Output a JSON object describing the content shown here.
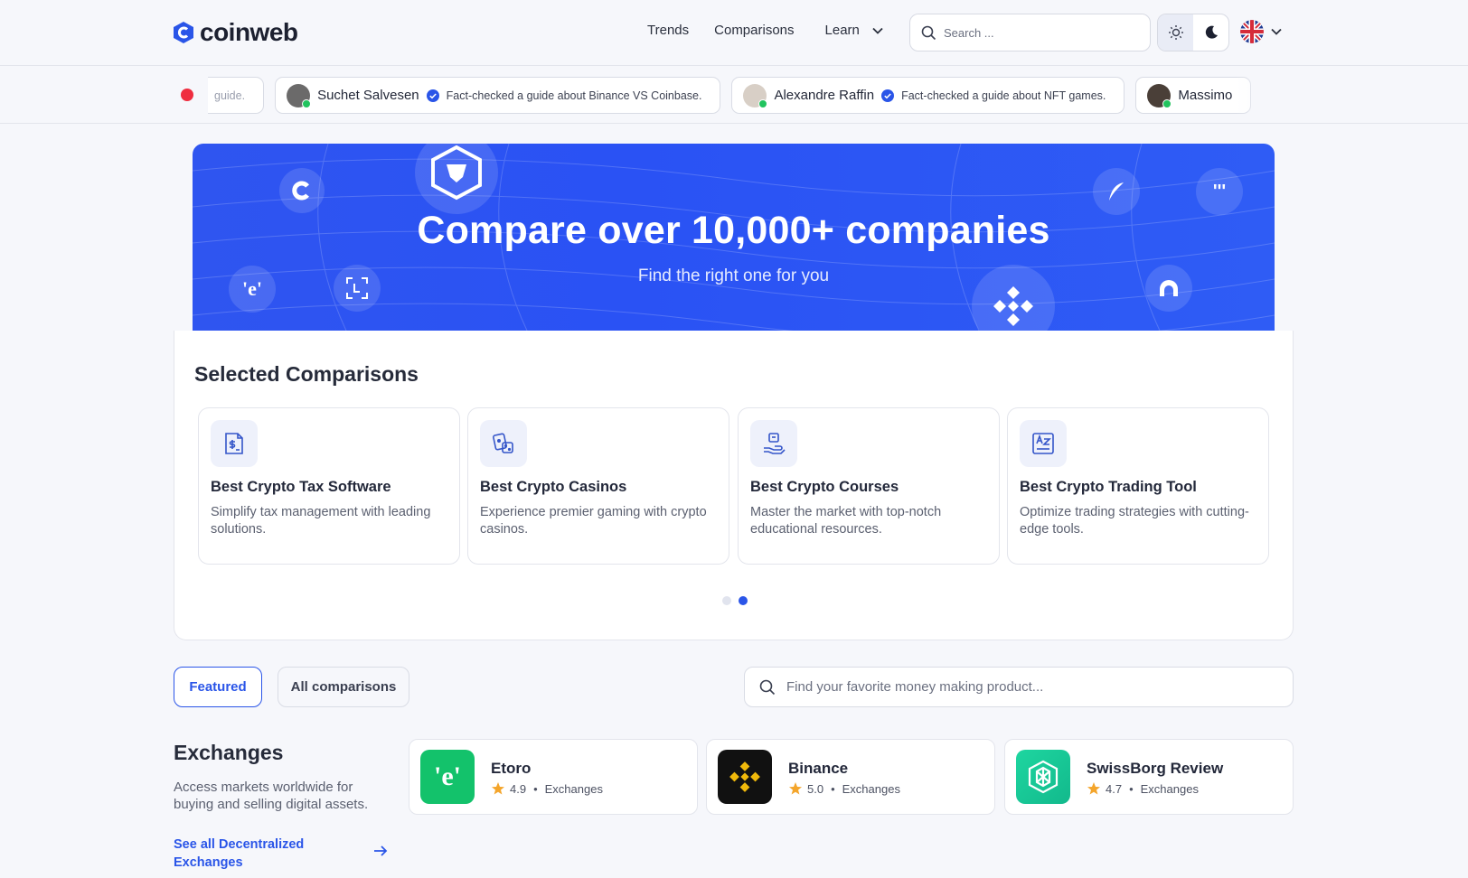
{
  "brand": {
    "name": "coinweb"
  },
  "nav": {
    "trends": "Trends",
    "comparisons": "Comparisons",
    "learn": "Learn"
  },
  "search": {
    "placeholder": "Search ..."
  },
  "ticker": {
    "items": [
      {
        "name": "",
        "desc": "guide."
      },
      {
        "name": "Suchet Salvesen",
        "desc": "Fact-checked a guide about Binance VS Coinbase."
      },
      {
        "name": "Alexandre Raffin",
        "desc": "Fact-checked a guide about NFT games."
      },
      {
        "name": "Massimo",
        "desc": ""
      }
    ]
  },
  "hero": {
    "title": "Compare over 10,000+ companies",
    "subtitle": "Find the right one for you"
  },
  "selected": {
    "title": "Selected Comparisons",
    "cards": [
      {
        "title": "Best Crypto Tax Software",
        "desc": "Simplify tax management with leading solutions.",
        "icon": "tax-document-icon"
      },
      {
        "title": "Best Crypto Casinos",
        "desc": "Experience premier gaming with crypto casinos.",
        "icon": "dice-cards-icon"
      },
      {
        "title": "Best Crypto Courses",
        "desc": "Master the market with top-notch educational resources.",
        "icon": "course-hand-icon"
      },
      {
        "title": "Best Crypto Trading Tool",
        "desc": "Optimize trading strategies with cutting-edge tools.",
        "icon": "az-book-icon"
      }
    ]
  },
  "filters": {
    "featured": "Featured",
    "all": "All comparisons",
    "find_placeholder": "Find your favorite money making product..."
  },
  "exchanges": {
    "title": "Exchanges",
    "desc": "Access markets worldwide for buying and selling digital assets.",
    "link": "See all Decentralized Exchanges",
    "products": [
      {
        "name": "Etoro",
        "rating": "4.9",
        "category": "Exchanges",
        "color": "#13c26b"
      },
      {
        "name": "Binance",
        "rating": "5.0",
        "category": "Exchanges",
        "color": "#111111"
      },
      {
        "name": "SwissBorg Review",
        "rating": "4.7",
        "category": "Exchanges",
        "color": "#17c79a"
      }
    ]
  },
  "colors": {
    "accent": "#2a55e8",
    "hero": "#2f55f0",
    "live": "#ef2d3f",
    "star": "#f4a52b"
  }
}
